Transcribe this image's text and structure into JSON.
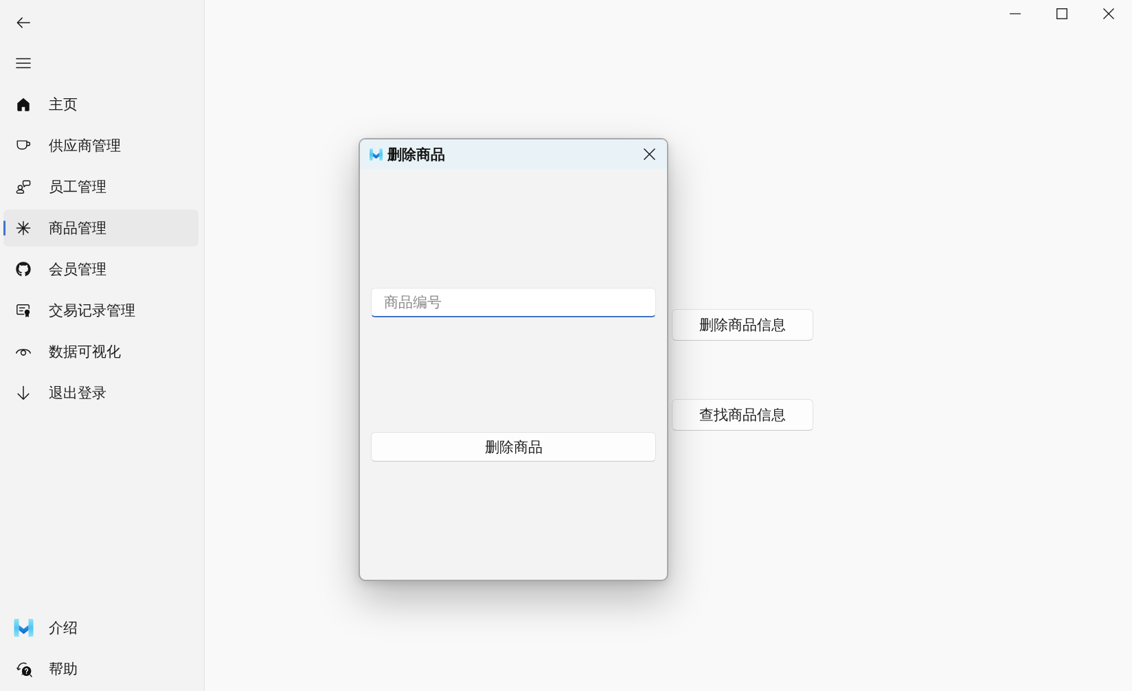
{
  "sidebar": {
    "items": [
      {
        "label": "主页",
        "selected": false
      },
      {
        "label": "供应商管理",
        "selected": false
      },
      {
        "label": "员工管理",
        "selected": false
      },
      {
        "label": "商品管理",
        "selected": true
      },
      {
        "label": "会员管理",
        "selected": false
      },
      {
        "label": "交易记录管理",
        "selected": false
      },
      {
        "label": "数据可视化",
        "selected": false
      },
      {
        "label": "退出登录",
        "selected": false
      }
    ],
    "footer_items": [
      {
        "label": "介绍",
        "selected": false
      },
      {
        "label": "帮助",
        "selected": false
      }
    ]
  },
  "main": {
    "buttons": [
      "删除商品信息",
      "查找商品信息"
    ]
  },
  "dialog": {
    "title": "删除商品",
    "input": {
      "placeholder": "商品编号",
      "focused": true
    },
    "button": "删除商品"
  }
}
